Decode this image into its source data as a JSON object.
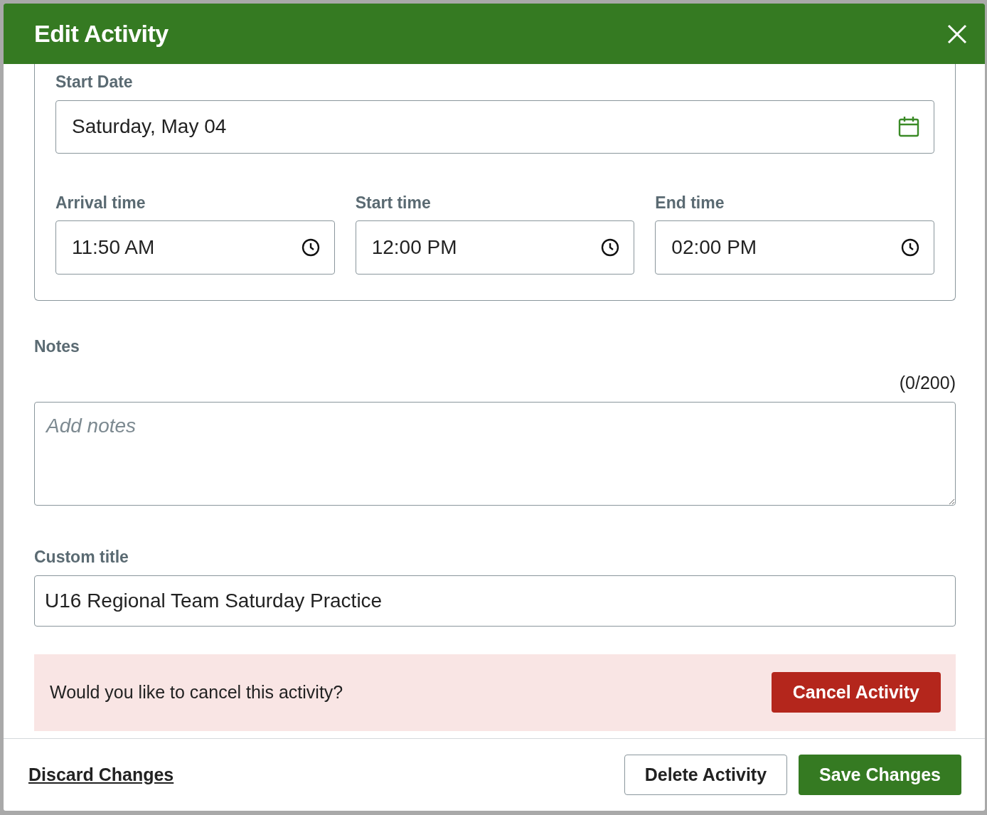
{
  "dialog": {
    "title": "Edit Activity"
  },
  "schedule": {
    "start_date": {
      "label": "Start Date",
      "value": "Saturday, May 04"
    },
    "times": [
      {
        "label": "Arrival time",
        "value": "11:50 AM"
      },
      {
        "label": "Start time",
        "value": "12:00 PM"
      },
      {
        "label": "End time",
        "value": "02:00 PM"
      }
    ]
  },
  "notes": {
    "label": "Notes",
    "counter": "(0/200)",
    "placeholder": "Add notes"
  },
  "custom_title": {
    "label": "Custom title",
    "value": "U16 Regional Team Saturday Practice"
  },
  "cancel_banner": {
    "text": "Would you like to cancel this activity?",
    "button": "Cancel Activity"
  },
  "footer": {
    "discard": "Discard Changes",
    "delete": "Delete Activity",
    "save": "Save Changes"
  }
}
